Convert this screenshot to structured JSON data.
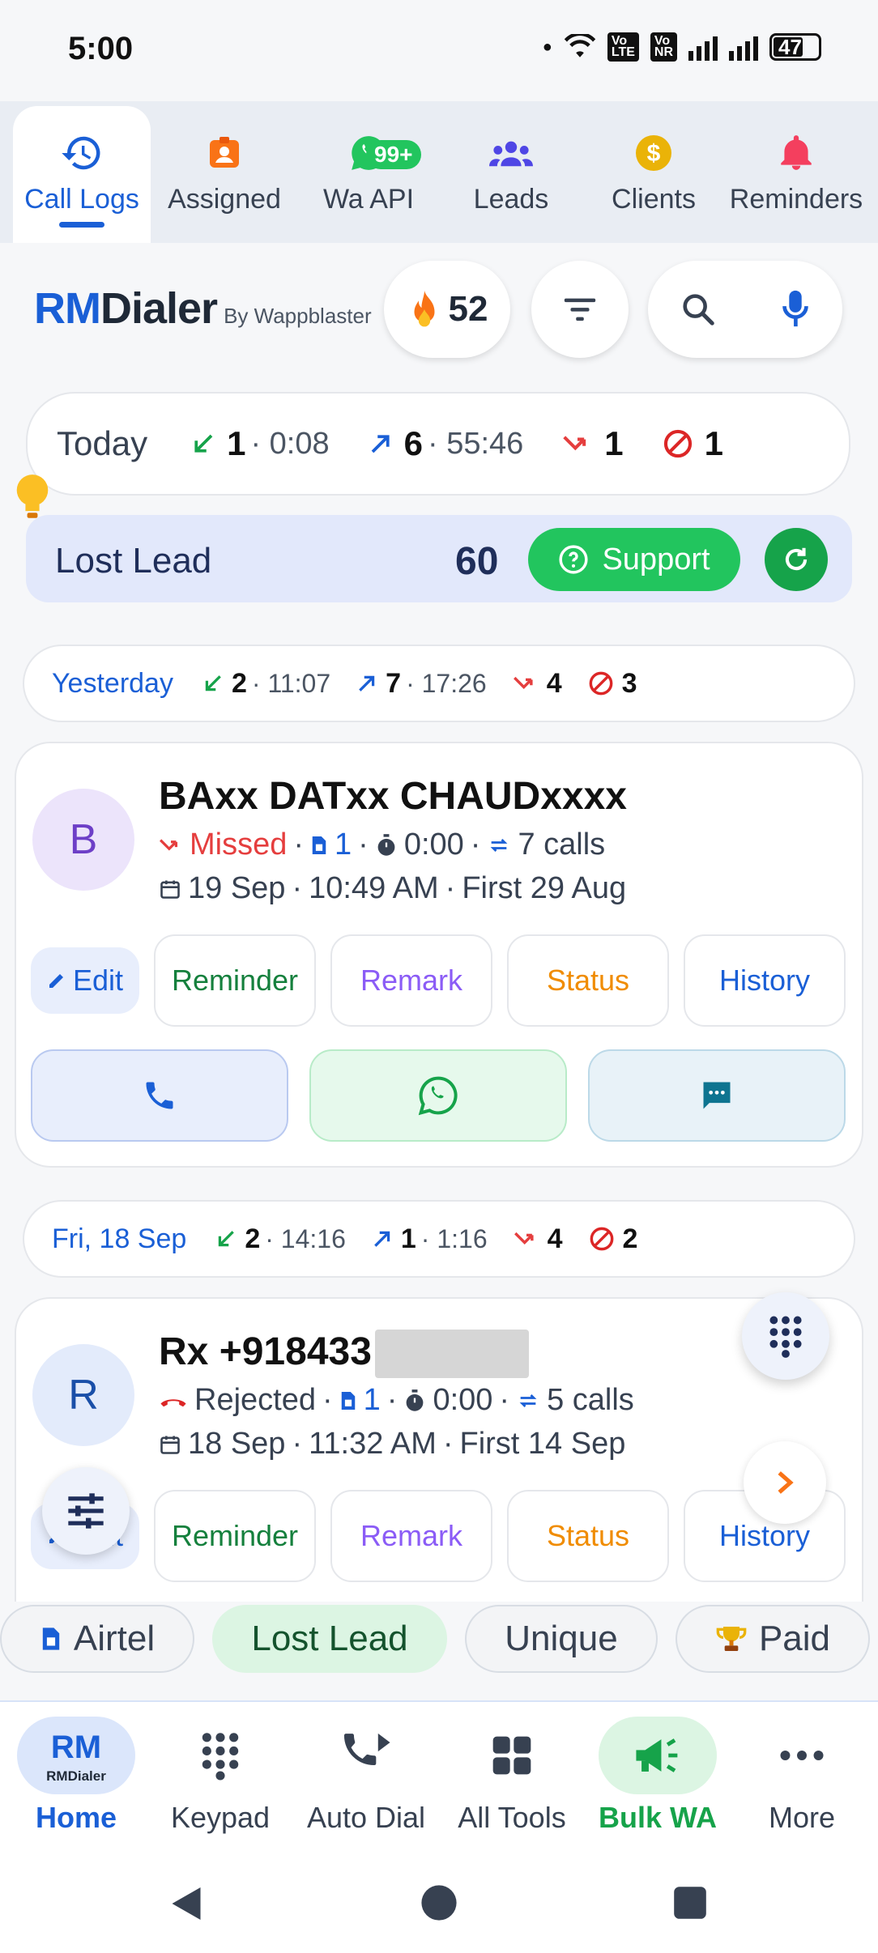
{
  "status_bar": {
    "time": "5:00",
    "battery": "47",
    "sim1": "Vo 2 LTE",
    "sim2": "Vo 1 NR"
  },
  "top_tabs": [
    {
      "label": "Call Logs",
      "icon": "history-icon",
      "active": true
    },
    {
      "label": "Assigned",
      "icon": "badge-icon"
    },
    {
      "label": "Wa API",
      "icon": "whatsapp-icon",
      "badge": "99+"
    },
    {
      "label": "Leads",
      "icon": "group-icon"
    },
    {
      "label": "Clients",
      "icon": "dollar-icon"
    },
    {
      "label": "Reminders",
      "icon": "bell-icon"
    }
  ],
  "header": {
    "brand_rm": "RM",
    "brand_dialer": "Dialer",
    "brand_by": "By Wappblaster",
    "streak": "52"
  },
  "today": {
    "label": "Today",
    "incoming_count": "1",
    "incoming_dur": "0:08",
    "outgoing_count": "6",
    "outgoing_dur": "55:46",
    "missed_count": "1",
    "rejected_count": "1"
  },
  "lost_lead": {
    "label": "Lost Lead",
    "count": "60",
    "support_label": "Support"
  },
  "day_groups": [
    {
      "label": "Yesterday",
      "incoming_count": "2",
      "incoming_dur": "11:07",
      "outgoing_count": "7",
      "outgoing_dur": "17:26",
      "missed_count": "4",
      "rejected_count": "3"
    },
    {
      "label": "Fri, 18 Sep",
      "incoming_count": "2",
      "incoming_dur": "14:16",
      "outgoing_count": "1",
      "outgoing_dur": "1:16",
      "missed_count": "4",
      "rejected_count": "2"
    }
  ],
  "contacts": [
    {
      "initial": "B",
      "name": "BAxx DATxx CHAUDxxxx",
      "status": "Missed",
      "sim": "1",
      "duration": "0:00",
      "calls": "7 calls",
      "date": "19 Sep",
      "time": "10:49 AM",
      "first": "First 29 Aug"
    },
    {
      "initial": "R",
      "name": "Rx +918433",
      "status": "Rejected",
      "sim": "1",
      "duration": "0:00",
      "calls": "5 calls",
      "date": "18 Sep",
      "time": "11:32 AM",
      "first": "First 14 Sep"
    }
  ],
  "actions": {
    "edit": "Edit",
    "reminder": "Reminder",
    "remark": "Remark",
    "status": "Status",
    "history": "History"
  },
  "chips": [
    {
      "label": "Airtel",
      "icon": "sim-icon"
    },
    {
      "label": "Lost Lead",
      "selected": true
    },
    {
      "label": "Unique"
    },
    {
      "label": "Paid",
      "icon": "trophy-icon"
    }
  ],
  "bottom_nav": [
    {
      "label": "Home",
      "active": true,
      "logo_text": "RMDialer"
    },
    {
      "label": "Keypad"
    },
    {
      "label": "Auto Dial"
    },
    {
      "label": "All Tools"
    },
    {
      "label": "Bulk WA",
      "highlight": true
    },
    {
      "label": "More"
    }
  ],
  "colors": {
    "primary": "#1a5fd6",
    "green": "#22c55e",
    "missed": "#e53e3e",
    "orange": "#f08c00",
    "purple": "#8b5cf6"
  }
}
